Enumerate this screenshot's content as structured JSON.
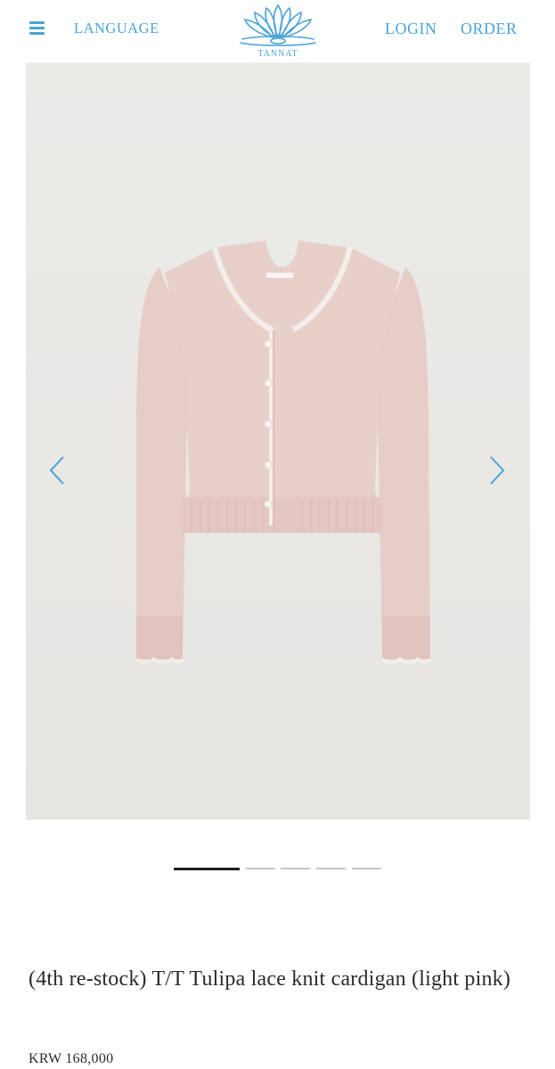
{
  "header": {
    "language_label": "LANGUAGE",
    "login_label": "LOGIN",
    "order_label": "ORDER",
    "logo_text": "TANNAT"
  },
  "gallery": {
    "slide_count": 5,
    "active_slide": 1
  },
  "product": {
    "title": "(4th re-stock) T/T Tulipa lace knit cardigan (light pink)",
    "price": "KRW 168,000"
  },
  "colors": {
    "accent": "#4aa3d6",
    "image_bg": "#e9e8e5",
    "knit": "#e7cfc9"
  }
}
